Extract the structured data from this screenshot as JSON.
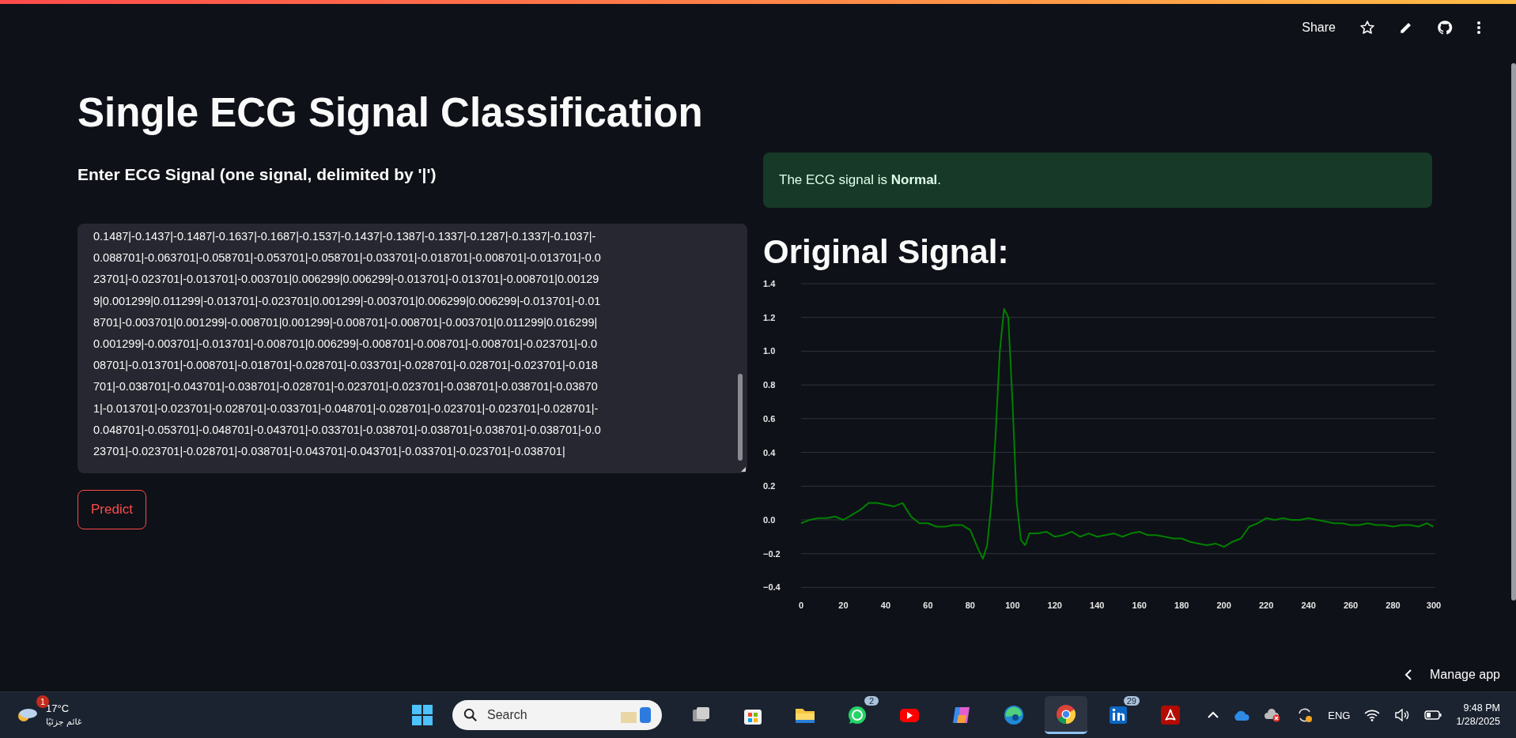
{
  "header": {
    "share": "Share"
  },
  "title": "Single ECG Signal Classification",
  "input": {
    "label": "Enter ECG Signal (one signal, delimited by '|')",
    "value": "0.1487|-0.1437|-0.1487|-0.1637|-0.1687|-0.1537|-0.1437|-0.1387|-0.1337|-0.1287|-0.1337|-0.1037|-\n0.088701|-0.063701|-0.058701|-0.053701|-0.058701|-0.033701|-0.018701|-0.008701|-0.013701|-0.0\n23701|-0.023701|-0.013701|-0.003701|0.006299|0.006299|-0.013701|-0.013701|-0.008701|0.00129\n9|0.001299|0.011299|-0.013701|-0.023701|0.001299|-0.003701|0.006299|0.006299|-0.013701|-0.01\n8701|-0.003701|0.001299|-0.008701|0.001299|-0.008701|-0.008701|-0.003701|0.011299|0.016299|\n0.001299|-0.003701|-0.013701|-0.008701|0.006299|-0.008701|-0.008701|-0.008701|-0.023701|-0.0\n08701|-0.013701|-0.008701|-0.018701|-0.028701|-0.033701|-0.028701|-0.028701|-0.023701|-0.018\n701|-0.038701|-0.043701|-0.038701|-0.028701|-0.023701|-0.023701|-0.038701|-0.038701|-0.03870\n1|-0.013701|-0.023701|-0.028701|-0.033701|-0.048701|-0.028701|-0.023701|-0.023701|-0.028701|-\n0.048701|-0.053701|-0.048701|-0.043701|-0.033701|-0.038701|-0.038701|-0.038701|-0.038701|-0.0\n23701|-0.023701|-0.028701|-0.038701|-0.043701|-0.043701|-0.033701|-0.023701|-0.038701|"
  },
  "predict_button": "Predict",
  "result": {
    "kind": "success",
    "message": "The ECG signal is **Normal**."
  },
  "chart_heading": "Original Signal:",
  "chart_data": {
    "type": "line",
    "x": [
      0,
      4,
      8,
      12,
      16,
      20,
      24,
      28,
      32,
      36,
      40,
      44,
      48,
      52,
      56,
      60,
      64,
      68,
      72,
      76,
      80,
      82,
      84,
      86,
      88,
      90,
      92,
      94,
      96,
      98,
      100,
      102,
      104,
      106,
      108,
      112,
      116,
      120,
      124,
      128,
      132,
      136,
      140,
      144,
      148,
      152,
      156,
      160,
      164,
      168,
      172,
      176,
      180,
      184,
      188,
      192,
      196,
      200,
      204,
      208,
      212,
      216,
      220,
      224,
      228,
      232,
      236,
      240,
      244,
      248,
      252,
      256,
      260,
      264,
      268,
      272,
      276,
      280,
      284,
      288,
      292,
      296,
      299
    ],
    "series": [
      {
        "color": "#008000",
        "values": [
          -0.02,
          0.0,
          0.01,
          0.01,
          0.02,
          0.0,
          0.03,
          0.06,
          0.1,
          0.1,
          0.09,
          0.08,
          0.1,
          0.02,
          -0.02,
          -0.02,
          -0.04,
          -0.04,
          -0.03,
          -0.03,
          -0.06,
          -0.12,
          -0.18,
          -0.23,
          -0.15,
          0.1,
          0.5,
          1.0,
          1.25,
          1.2,
          0.7,
          0.1,
          -0.12,
          -0.15,
          -0.08,
          -0.08,
          -0.07,
          -0.1,
          -0.09,
          -0.07,
          -0.1,
          -0.08,
          -0.1,
          -0.09,
          -0.08,
          -0.1,
          -0.08,
          -0.07,
          -0.09,
          -0.09,
          -0.1,
          -0.11,
          -0.11,
          -0.13,
          -0.14,
          -0.15,
          -0.14,
          -0.16,
          -0.13,
          -0.11,
          -0.04,
          -0.02,
          0.01,
          0.0,
          0.01,
          0.0,
          0.0,
          0.01,
          0.0,
          -0.01,
          -0.02,
          -0.02,
          -0.03,
          -0.03,
          -0.02,
          -0.03,
          -0.03,
          -0.04,
          -0.03,
          -0.03,
          -0.04,
          -0.02,
          -0.04
        ]
      }
    ],
    "xlim": [
      0,
      300
    ],
    "ylim": [
      -0.4,
      1.4
    ],
    "grid": true,
    "xticks": [
      0,
      20,
      40,
      60,
      80,
      100,
      120,
      140,
      160,
      180,
      200,
      220,
      240,
      260,
      280,
      300
    ],
    "yticks": [
      {
        "value": -0.4,
        "label": "−0.4"
      },
      {
        "value": -0.2,
        "label": "−0.2"
      },
      {
        "value": 0,
        "label": "0.0"
      },
      {
        "value": 0.2,
        "label": "0.2"
      },
      {
        "value": 0.4,
        "label": "0.4"
      },
      {
        "value": 0.6,
        "label": "0.6"
      },
      {
        "value": 0.8,
        "label": "0.8"
      },
      {
        "value": 1,
        "label": "1.0"
      },
      {
        "value": 1.2,
        "label": "1.2"
      },
      {
        "value": 1.4,
        "label": "1.4"
      }
    ]
  },
  "manage_app": "Manage app",
  "taskbar": {
    "weather": {
      "badge": "1",
      "temperature": "17°C",
      "condition": "غائم جزئيًا"
    },
    "search_placeholder": "Search",
    "apps": [
      {
        "kind": "taskview",
        "selected": false
      },
      {
        "kind": "store",
        "selected": false
      },
      {
        "kind": "files",
        "selected": false
      },
      {
        "kind": "whatsapp",
        "badge": "2",
        "selected": false
      },
      {
        "kind": "youtube",
        "selected": false
      },
      {
        "kind": "copilot",
        "selected": false
      },
      {
        "kind": "edge",
        "selected": false
      },
      {
        "kind": "chrome",
        "selected": true
      },
      {
        "kind": "linkedin",
        "badge": "29",
        "selected": false
      },
      {
        "kind": "acrobat",
        "selected": false
      }
    ],
    "language": "ENG",
    "time": "9:48 PM",
    "date": "1/28/2025"
  }
}
